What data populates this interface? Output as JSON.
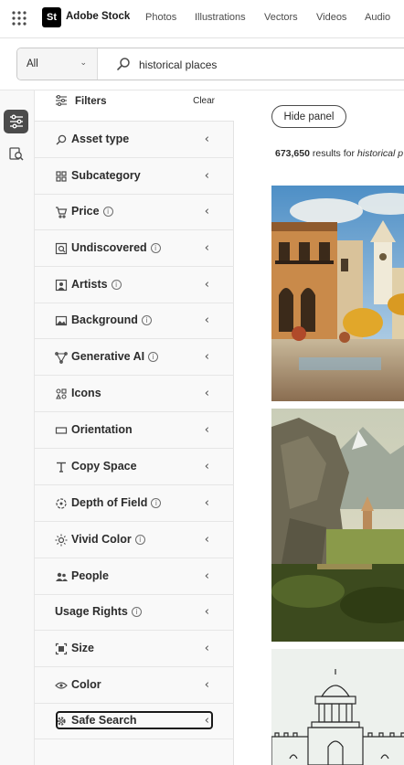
{
  "header": {
    "logo_text": "St",
    "brand": "Adobe Stock",
    "nav": [
      "Photos",
      "Illustrations",
      "Vectors",
      "Videos",
      "Audio"
    ]
  },
  "search": {
    "type_value": "All",
    "query": "historical places"
  },
  "filters": {
    "title": "Filters",
    "clear_label": "Clear",
    "items": [
      {
        "label": "Asset type",
        "icon": "search-icon",
        "info": false
      },
      {
        "label": "Subcategory",
        "icon": "grid-icon",
        "info": false
      },
      {
        "label": "Price",
        "icon": "cart-icon",
        "info": true
      },
      {
        "label": "Undiscovered",
        "icon": "discover-icon",
        "info": true
      },
      {
        "label": "Artists",
        "icon": "artist-icon",
        "info": true
      },
      {
        "label": "Background",
        "icon": "image-icon",
        "info": true
      },
      {
        "label": "Generative AI",
        "icon": "generative-icon",
        "info": true
      },
      {
        "label": "Icons",
        "icon": "shapes-icon",
        "info": false
      },
      {
        "label": "Orientation",
        "icon": "orientation-icon",
        "info": false
      },
      {
        "label": "Copy Space",
        "icon": "text-icon",
        "info": false
      },
      {
        "label": "Depth of Field",
        "icon": "aperture-icon",
        "info": true
      },
      {
        "label": "Vivid Color",
        "icon": "sun-icon",
        "info": true
      },
      {
        "label": "People",
        "icon": "people-icon",
        "info": false
      },
      {
        "label": "Usage Rights",
        "icon": "",
        "info": true
      },
      {
        "label": "Size",
        "icon": "size-icon",
        "info": false
      },
      {
        "label": "Color",
        "icon": "eye-icon",
        "info": false
      },
      {
        "label": "Safe Search",
        "icon": "gear-icon",
        "info": false
      }
    ]
  },
  "results": {
    "hide_panel_label": "Hide panel",
    "count": "673,650",
    "count_text": " results for ",
    "query_italic": "historical p"
  },
  "colors": {
    "accent_dark": "#4b4b4b",
    "brand_black": "#000000",
    "panel_bg": "#f9f9f9"
  }
}
